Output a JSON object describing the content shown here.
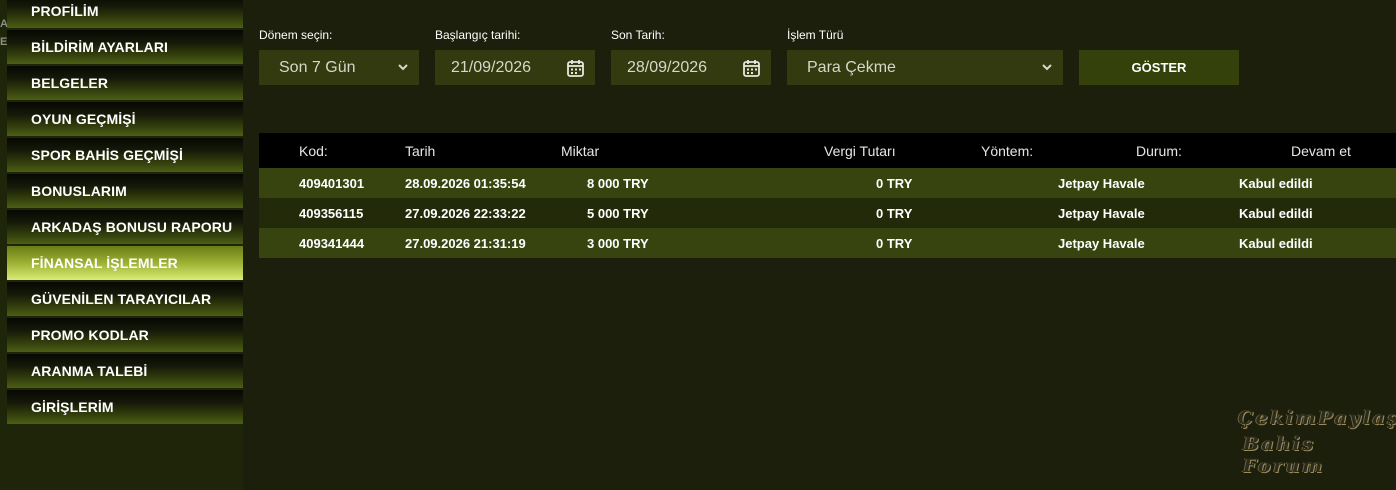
{
  "sidebar": {
    "edge_marks": [
      "A",
      "E"
    ],
    "items": [
      {
        "label": "PROFİLİM",
        "active": false
      },
      {
        "label": "BİLDİRİM AYARLARI",
        "active": false
      },
      {
        "label": "BELGELER",
        "active": false
      },
      {
        "label": "OYUN GEÇMİŞİ",
        "active": false
      },
      {
        "label": "SPOR BAHİS GEÇMİŞİ",
        "active": false
      },
      {
        "label": "BONUSLARIM",
        "active": false
      },
      {
        "label": "ARKADAŞ BONUSU RAPORU",
        "active": false
      },
      {
        "label": "FİNANSAL İŞLEMLER",
        "active": true
      },
      {
        "label": "GÜVENİLEN TARAYICILAR",
        "active": false
      },
      {
        "label": "PROMO KODLAR",
        "active": false
      },
      {
        "label": "ARANMA TALEBİ",
        "active": false
      },
      {
        "label": "GİRİŞLERİM",
        "active": false
      }
    ]
  },
  "filters": {
    "period": {
      "label": "Dönem seçin:",
      "value": "Son 7 Gün",
      "icon": "chevron-down-icon"
    },
    "start_date": {
      "label": "Başlangıç tarihi:",
      "value": "21/09/2026",
      "icon": "calendar-icon"
    },
    "end_date": {
      "label": "Son Tarih:",
      "value": "28/09/2026",
      "icon": "calendar-icon"
    },
    "type": {
      "label": "İşlem Türü",
      "value": "Para Çekme",
      "icon": "chevron-down-icon"
    },
    "show_button": "GÖSTER"
  },
  "table": {
    "headers": {
      "code": "Kod:",
      "date": "Tarih",
      "amount": "Miktar",
      "tax": "Vergi Tutarı",
      "method": "Yöntem:",
      "status": "Durum:",
      "more": "Devam et"
    },
    "rows": [
      {
        "code": "409401301",
        "date": "28.09.2026 01:35:54",
        "amount": "8 000 TRY",
        "tax": "0 TRY",
        "method": "Jetpay Havale",
        "status": "Kabul edildi"
      },
      {
        "code": "409356115",
        "date": "27.09.2026 22:33:22",
        "amount": "5 000 TRY",
        "tax": "0 TRY",
        "method": "Jetpay Havale",
        "status": "Kabul edildi"
      },
      {
        "code": "409341444",
        "date": "27.09.2026 21:31:19",
        "amount": "3 000 TRY",
        "tax": "0 TRY",
        "method": "Jetpay Havale",
        "status": "Kabul edildi"
      }
    ]
  },
  "watermark": {
    "line1": "ÇekimPaylaş",
    "line2": "Bahis Forum"
  },
  "colors": {
    "accent": "#34410b",
    "row_odd": "#384410",
    "row_even": "#222a0a",
    "background": "#1c1f0b"
  }
}
